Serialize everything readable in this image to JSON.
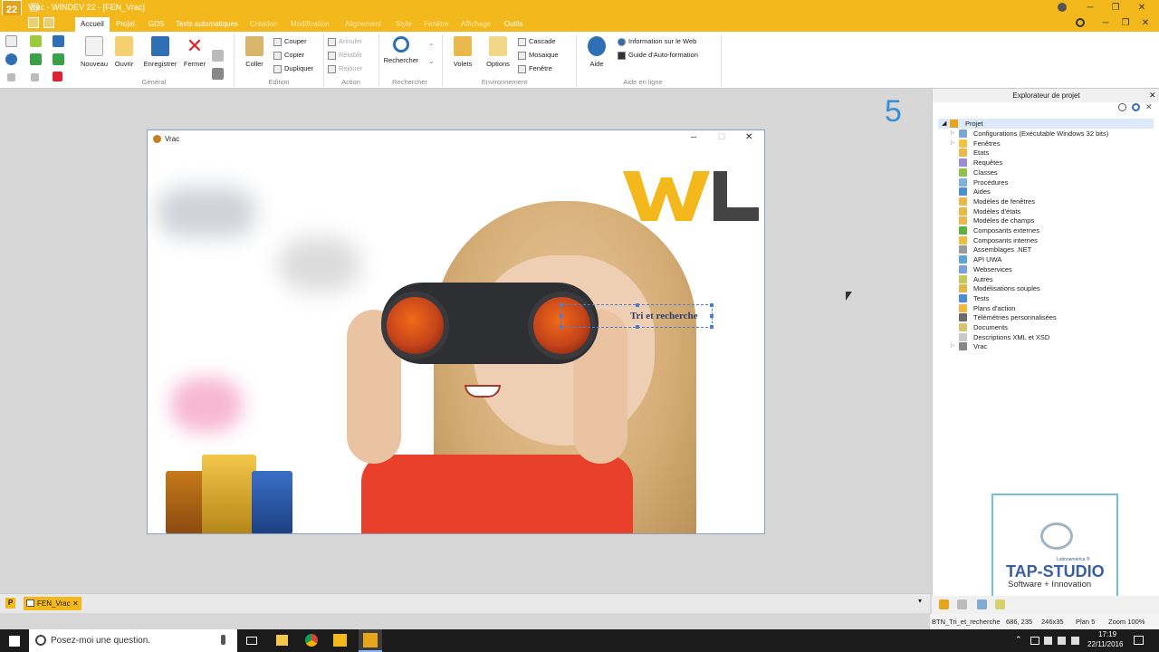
{
  "titlebar": {
    "title": "Vrac - WINDEV 22 - [FEN_Vrac]",
    "logo": "22"
  },
  "tabs": [
    "Accueil",
    "Projet",
    "GDS",
    "Tests automatiques",
    "Création",
    "Modification",
    "Alignement",
    "Style",
    "Fenêtre",
    "Affichage",
    "Outils"
  ],
  "ribbon": {
    "general": {
      "nouveau": "Nouveau",
      "ouvrir": "Ouvrir",
      "enregistrer": "Enregistrer",
      "fermer": "Fermer",
      "group": "Général"
    },
    "edition": {
      "coller": "Coller",
      "couper": "Couper",
      "copier": "Copier",
      "dupliquer": "Dupliquer",
      "group": "Edition"
    },
    "action": {
      "annuler": "Annuler",
      "retablir": "Rétablir",
      "rejouer": "Rejouer",
      "group": "Action"
    },
    "rechercher": {
      "btn": "Rechercher",
      "group": "Rechercher"
    },
    "environnement": {
      "volets": "Volets",
      "options": "Options",
      "cascade": "Cascade",
      "mosaique": "Mosaique",
      "fenetre": "Fenêtre",
      "group": "Environnement"
    },
    "aide": {
      "aide": "Aide",
      "info": "Information sur le Web",
      "guide": "Guide d'Auto-formation",
      "group": "Aide en ligne"
    }
  },
  "workspace": {
    "big_number": "5"
  },
  "window": {
    "title": "Vrac",
    "button_label": "Tri et recherche"
  },
  "panel": {
    "title": "Explorateur de projet",
    "root": "Projet",
    "items": [
      "Configurations (Exécutable Windows 32 bits)",
      "Fenêtres",
      "Etats",
      "Requêtes",
      "Classes",
      "Procédures",
      "Aides",
      "Modèles de fenêtres",
      "Modèles d'états",
      "Modèles de champs",
      "Composants externes",
      "Composants internes",
      "Assemblages .NET",
      "API UWA",
      "Webservices",
      "Autres",
      "Modélisations souples",
      "Tests",
      "Plans d'action",
      "Télémétries personnalisées",
      "Documents",
      "Descriptions XML et XSD",
      "Vrac"
    ]
  },
  "tap": {
    "latin": "Latinoamérica ®",
    "brand": "TAP-STUDIO",
    "tagline": "Software + Innovation"
  },
  "doctab": {
    "label": "FEN_Vrac"
  },
  "status": {
    "name": "BTN_Tri_et_recherche",
    "pos": "686, 235",
    "size": "246x35",
    "plan": "Plan 5",
    "zoom": "Zoom 100%"
  },
  "taskbar": {
    "search": "Posez-moi une question.",
    "time": "17:19",
    "date": "22/11/2016"
  },
  "colors": {
    "accent": "#f3b81b",
    "blue": "#3b8fd6"
  }
}
